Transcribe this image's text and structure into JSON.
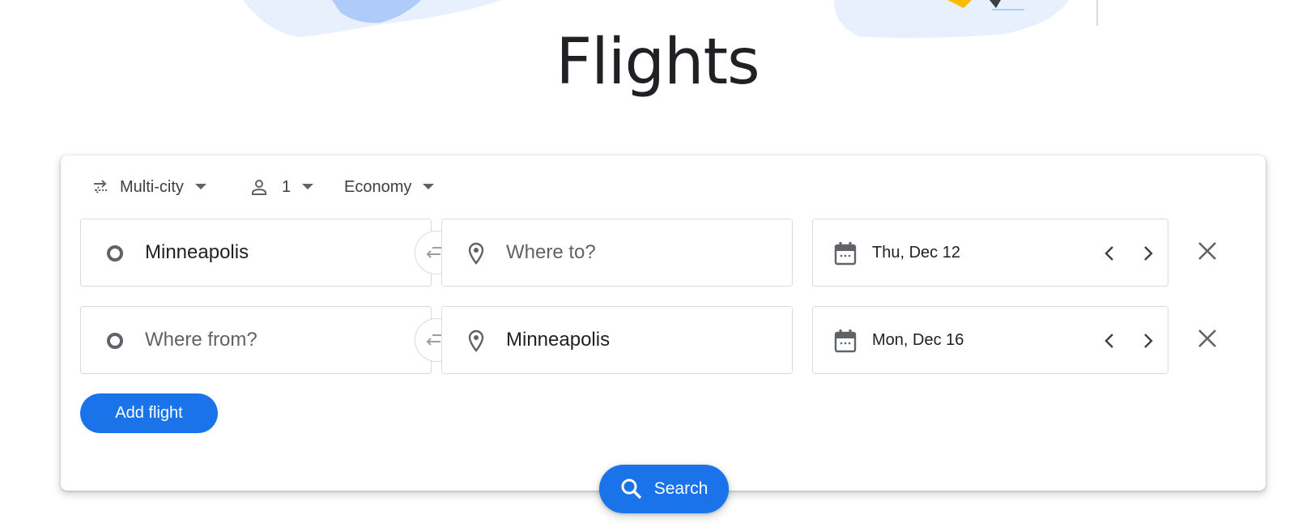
{
  "page": {
    "title": "Flights"
  },
  "options": {
    "trip_type": "Multi-city",
    "passengers": "1",
    "cabin_class": "Economy"
  },
  "legs": [
    {
      "origin": "Minneapolis",
      "destination_placeholder": "Where to?",
      "date": "Thu, Dec 12"
    },
    {
      "origin_placeholder": "Where from?",
      "destination": "Minneapolis",
      "date": "Mon, Dec 16"
    }
  ],
  "actions": {
    "add_flight": "Add flight",
    "search": "Search"
  },
  "colors": {
    "accent": "#1a73e8",
    "icon": "#5f6368",
    "text": "#202124",
    "border": "#dadce0",
    "hero_light": "#e8f0fe",
    "hero_mid": "#aecbfa",
    "hero_yellow": "#fbbc04"
  },
  "icons": {
    "trip_type": "swap-arrows-icon",
    "passengers": "person-icon",
    "origin": "circle-outline-icon",
    "destination": "location-pin-icon",
    "swap": "swap-arrows-icon",
    "date": "calendar-icon",
    "prev": "chevron-left-icon",
    "next": "chevron-right-icon",
    "remove": "close-icon",
    "search": "search-icon"
  }
}
